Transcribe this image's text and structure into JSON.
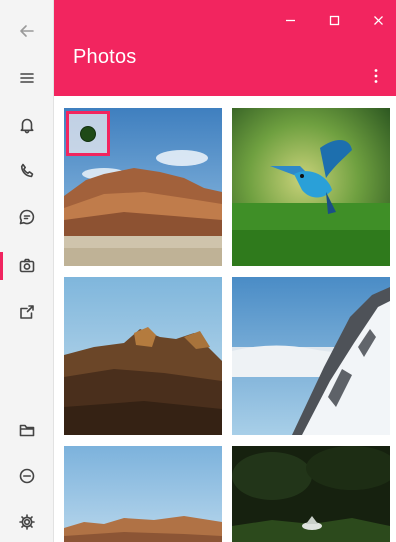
{
  "app": {
    "title": "Photos"
  },
  "window_controls": [
    "minimize-icon",
    "maximize-icon",
    "close-icon"
  ],
  "sidebar": {
    "items": [
      {
        "name": "back-icon"
      },
      {
        "name": "menu-icon"
      },
      {
        "name": "bell-icon"
      },
      {
        "name": "phone-icon"
      },
      {
        "name": "chat-icon"
      },
      {
        "name": "camera-icon",
        "active": true
      },
      {
        "name": "share-icon"
      },
      {
        "name": "folder-icon"
      },
      {
        "name": "minus-circle-icon"
      },
      {
        "name": "gear-icon"
      }
    ]
  },
  "colors": {
    "accent": "#f2255f",
    "sidebar_bg": "#f4f4f4",
    "window_bg": "#ffffff"
  },
  "gallery": {
    "photos": [
      {
        "subject": "desert-mesa",
        "selected": true
      },
      {
        "subject": "hummingbird"
      },
      {
        "subject": "rocky-hill-at-dusk"
      },
      {
        "subject": "snowy-mountain"
      },
      {
        "subject": "desert-plateau"
      },
      {
        "subject": "dark-forest"
      }
    ]
  }
}
